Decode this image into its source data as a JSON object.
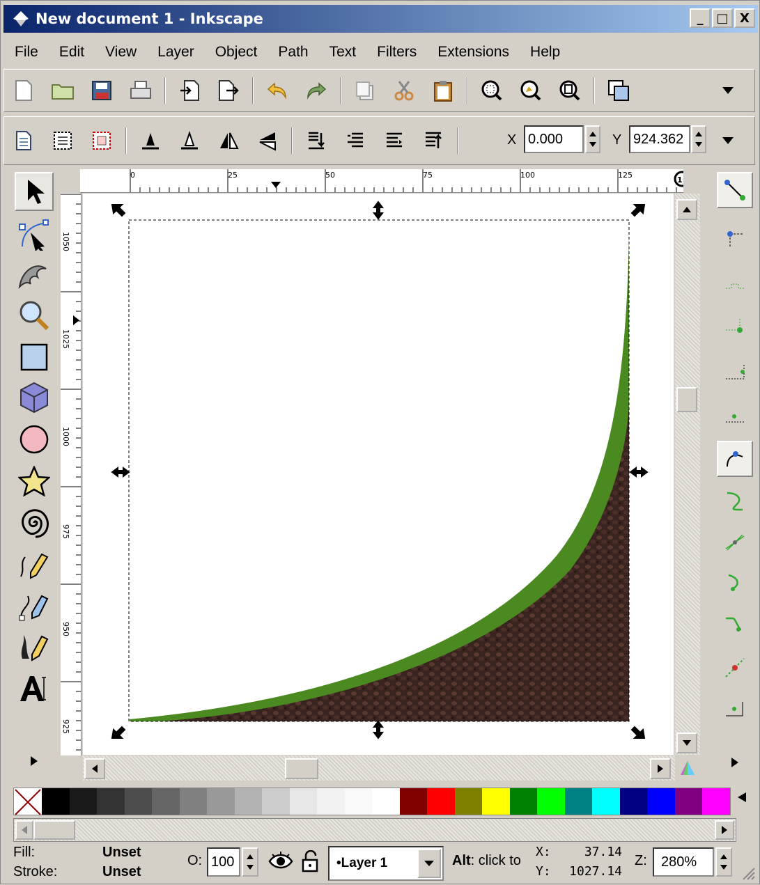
{
  "window": {
    "title": "New document 1 - Inkscape",
    "minimize": "_",
    "maximize": "□",
    "close": "X"
  },
  "menu": [
    "File",
    "Edit",
    "View",
    "Layer",
    "Object",
    "Path",
    "Text",
    "Filters",
    "Extensions",
    "Help"
  ],
  "coords_toolbar": {
    "x_label": "X",
    "x_value": "0.000",
    "y_label": "Y",
    "y_value": "924.362"
  },
  "hruler_labels": [
    "0",
    "25",
    "50",
    "75",
    "100",
    "125"
  ],
  "vruler_labels": [
    "1050",
    "1025",
    "1000",
    "975",
    "950",
    "925"
  ],
  "palette_colors": [
    "#000000",
    "#1a1a1a",
    "#333333",
    "#4d4d4d",
    "#666666",
    "#808080",
    "#999999",
    "#b3b3b3",
    "#cccccc",
    "#e6e6e6",
    "#f2f2f2",
    "#f9f9f9",
    "#ffffff",
    "#800000",
    "#ff0000",
    "#808000",
    "#ffff00",
    "#008000",
    "#00ff00",
    "#008080",
    "#00ffff",
    "#000080",
    "#0000ff",
    "#800080",
    "#ff00ff"
  ],
  "status": {
    "fill_label": "Fill:",
    "fill_value": "Unset",
    "stroke_label": "Stroke:",
    "stroke_value": "Unset",
    "opacity_label": "O:",
    "opacity_value": "100",
    "layer": "•Layer 1",
    "hint_bold": "Alt",
    "hint": ": click to",
    "x_label": "X:",
    "x_value": "37.14",
    "y_label": "Y:",
    "y_value": "1027.14",
    "zoom_label": "Z:",
    "zoom_value": "280%"
  }
}
